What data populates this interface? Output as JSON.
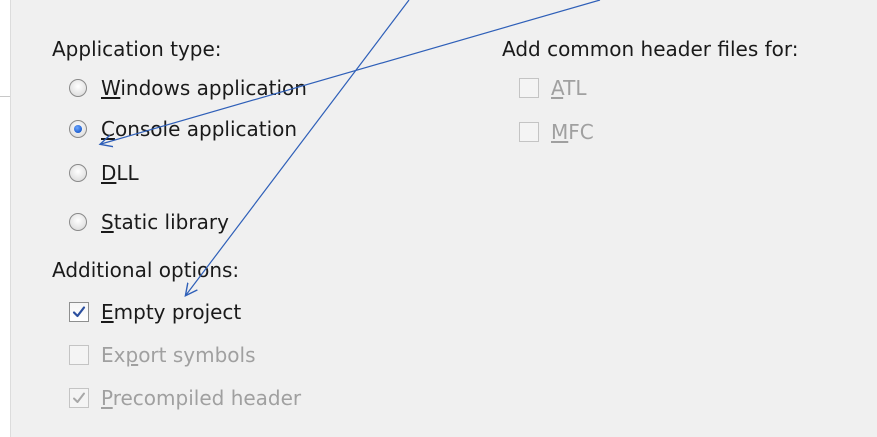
{
  "application_type": {
    "label": "Application type:",
    "options": [
      {
        "mnemonic": "W",
        "rest": "indows application",
        "checked": false
      },
      {
        "mnemonic": "C",
        "rest": "onsole application",
        "checked": true
      },
      {
        "mnemonic": "D",
        "rest": "LL",
        "checked": false
      },
      {
        "mnemonic": "S",
        "rest": "tatic library",
        "checked": false
      }
    ]
  },
  "additional_options": {
    "label": "Additional options:",
    "empty_project": {
      "mnemonic": "E",
      "rest": "mpty project",
      "checked": true,
      "enabled": true
    },
    "export_symbols": {
      "pre": "Ex",
      "mnemonic": "p",
      "rest": "ort symbols",
      "checked": false,
      "enabled": false
    },
    "precompiled_header": {
      "mnemonic": "P",
      "rest": "recompiled header",
      "checked": true,
      "enabled": false
    }
  },
  "common_headers": {
    "label": "Add common header files for:",
    "atl": {
      "mnemonic": "A",
      "rest": "TL",
      "checked": false,
      "enabled": false
    },
    "mfc": {
      "mnemonic": "M",
      "rest": "FC",
      "checked": false,
      "enabled": false
    }
  },
  "colors": {
    "annotation_arrow": "#2e5fb8",
    "radio_selected": "#1e5fcf",
    "checkmark": "#2b4f9e",
    "disabled_text": "#a0a0a0"
  }
}
